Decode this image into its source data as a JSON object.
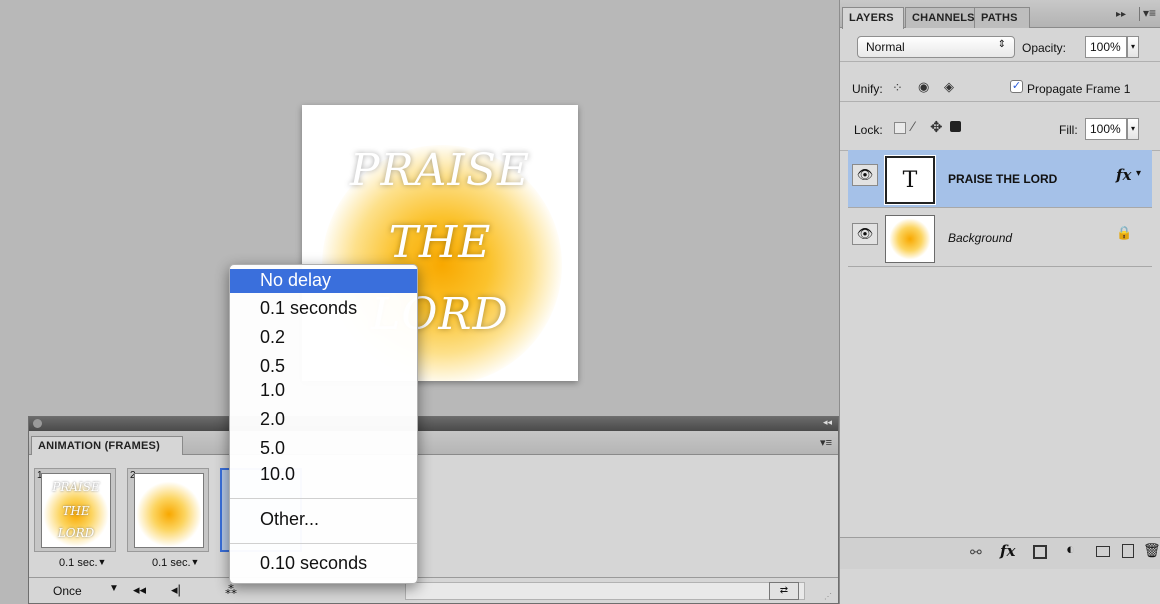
{
  "canvas": {
    "lines": [
      "PRAISE",
      "THE",
      "LORD"
    ]
  },
  "layers_panel": {
    "tabs": [
      "LAYERS",
      "CHANNELS",
      "PATHS"
    ],
    "blend_mode": "Normal",
    "opacity_label": "Opacity:",
    "opacity_value": "100%",
    "unify_label": "Unify:",
    "propagate_label": "Propagate Frame 1",
    "lock_label": "Lock:",
    "fill_label": "Fill:",
    "fill_value": "100%",
    "layers": [
      {
        "name": "PRAISE THE LORD",
        "type": "text",
        "thumb_glyph": "T",
        "fx": "fx"
      },
      {
        "name": "Background",
        "type": "image"
      }
    ]
  },
  "animation_panel": {
    "tab": "ANIMATION (FRAMES)",
    "frames": [
      {
        "num": "1",
        "time": "0.1 sec.",
        "thumb_lines": [
          "PRAISE",
          "THE",
          "LORD"
        ]
      },
      {
        "num": "2",
        "time": "0.1 sec."
      }
    ],
    "loop": "Once"
  },
  "delay_menu": {
    "items": [
      "No delay",
      "0.1 seconds",
      "0.2",
      "0.5",
      "1.0",
      "2.0",
      "5.0",
      "10.0"
    ],
    "other": "Other...",
    "current": "0.10 seconds"
  },
  "colors": {
    "accent": "#3a6fdc",
    "selected_layer": "#a5c1e8",
    "glow": "#f8a800"
  }
}
